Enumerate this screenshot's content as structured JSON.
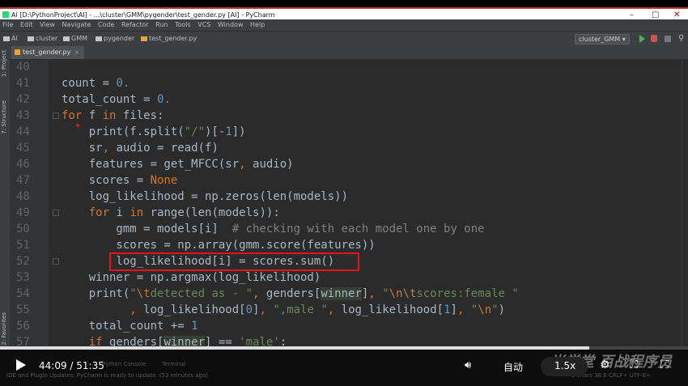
{
  "window": {
    "title": "AI [D:\\PythonProject\\AI] - ...\\cluster\\GMM\\pygender\\test_gender.py [AI] - PyCharm",
    "minimize": "–",
    "maximize": "▢",
    "close": "✕"
  },
  "menu": [
    "File",
    "Edit",
    "View",
    "Navigate",
    "Code",
    "Refactor",
    "Run",
    "Tools",
    "VCS",
    "Window",
    "Help"
  ],
  "breadcrumbs": [
    "AI",
    "cluster",
    "GMM",
    "pygender",
    "test_gender.py"
  ],
  "run_config": "cluster_GMM ▾",
  "tab": {
    "label": "test_gender.py",
    "close": "×"
  },
  "side_panels": [
    "1: Project",
    "7: Structure",
    "2: Favorites"
  ],
  "line_numbers": [
    "40",
    "41",
    "42",
    "43",
    "44",
    "45",
    "46",
    "47",
    "48",
    "49",
    "50",
    "51",
    "52",
    "53",
    "54",
    "55",
    "56",
    "57"
  ],
  "status_fragments": {
    "left": "IDE and Plugin Updates: PyCharm is ready to update. (53 minutes ago)",
    "python_console": "Python Console",
    "terminal": "Terminal",
    "right": "5 chars   38:6  CRLF÷  UTF-8÷"
  },
  "player": {
    "current_time": "44:09",
    "total_time": "51:35",
    "time_display": "44:09 / 51:35",
    "progress": 0.856,
    "quality": "自动",
    "speed": "1.5x",
    "watermark": "尚学堂 百战程序员"
  },
  "colors": {
    "highlight_box": "#e8121a",
    "keyword": "#cc7832",
    "number": "#6897bb",
    "string": "#6a8759",
    "comment": "#808080"
  }
}
